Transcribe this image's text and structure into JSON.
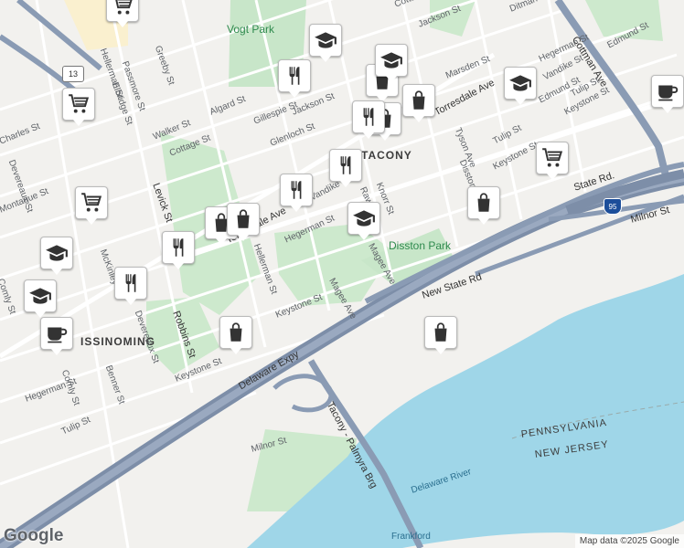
{
  "map": {
    "attribution": "Map data ©2025 Google",
    "logo": "Google",
    "neighborhoods": [
      "TACONY",
      "ISSINOMING"
    ],
    "parks": [
      "Vogt Park",
      "Disston Park"
    ],
    "water": [
      "Delaware River",
      "Frankford"
    ],
    "states": [
      "PENNSYLVANIA",
      "NEW JERSEY"
    ],
    "highways": [
      "Delaware Expy",
      "Tacony - Palmyra Brg",
      "New State Rd",
      "State Rd.",
      "Milnor St",
      "Cottman Ave",
      "Torresdale Ave"
    ],
    "shields": [
      "13",
      "95"
    ],
    "streets": [
      "Jackson St",
      "Cottage St",
      "Marsden St",
      "Torresdale Ave",
      "Vandike St",
      "Hegerman St",
      "Edmund St",
      "Tulip St",
      "Keystone St",
      "Tyson Ave",
      "Disston St",
      "Knorr St",
      "Glenloch St",
      "Gillespie St",
      "Algard St",
      "Walker St",
      "Levick St",
      "Robbins St",
      "Magee Ave",
      "Devereaux St",
      "Benner St",
      "Comly St",
      "McKinley St",
      "Greeby St",
      "Passmore St",
      "Elbridge St",
      "Hellerman St",
      "Charles St",
      "Montague St",
      "Milnor St",
      "Rawle St",
      "Ditman St"
    ],
    "poi_icons": [
      "shopping-bag",
      "restaurant",
      "school",
      "grocery-cart",
      "cafe"
    ]
  }
}
